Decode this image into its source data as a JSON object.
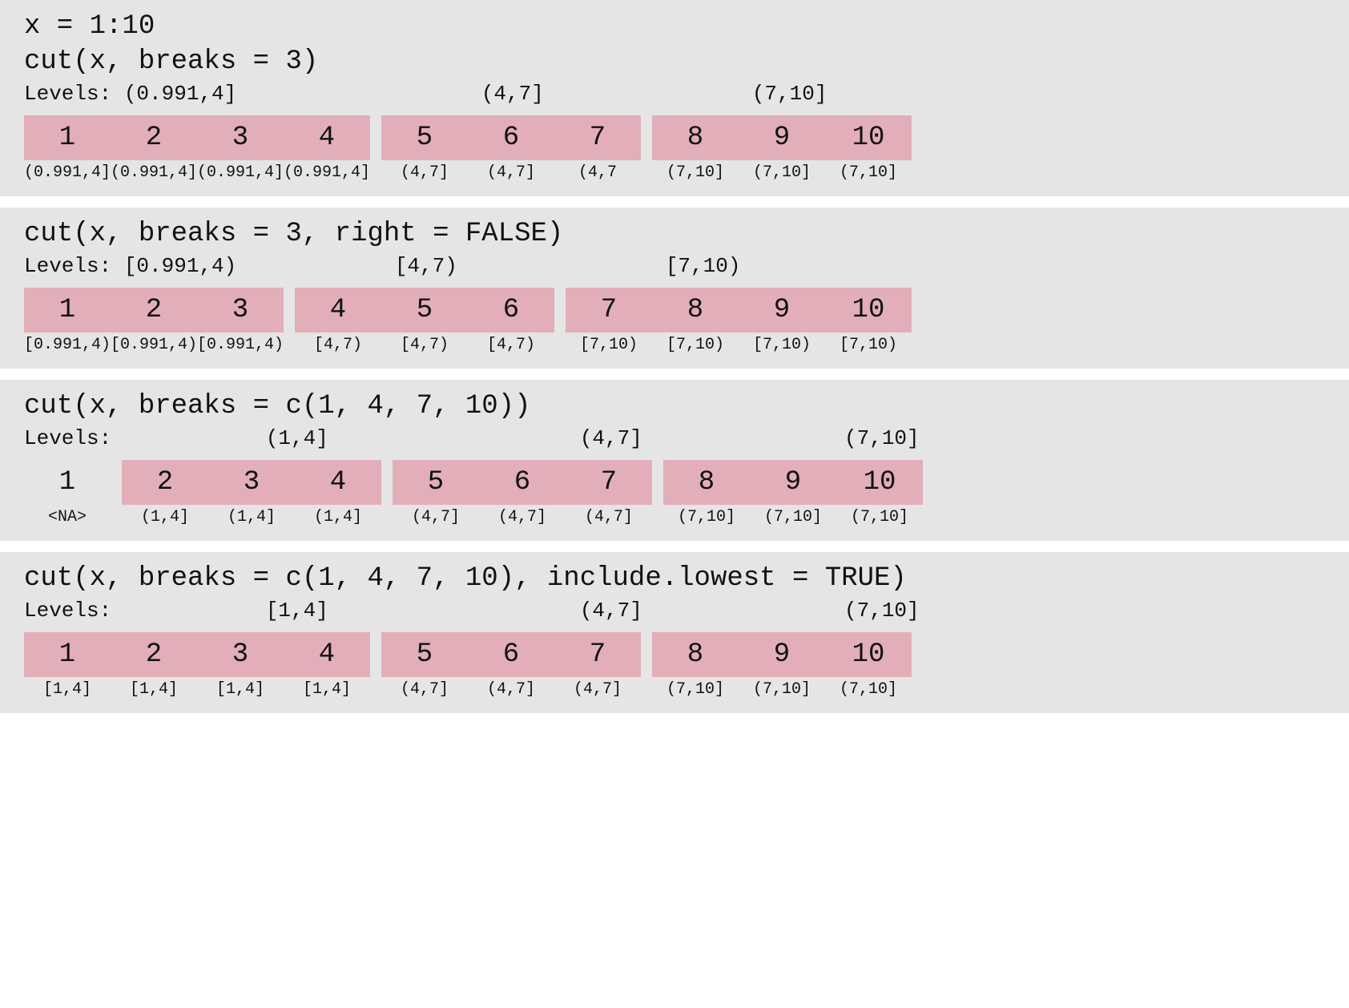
{
  "panels": [
    {
      "preCode": [
        "x = 1:10"
      ],
      "code": "cut(x, breaks = 3)",
      "levelsLabel": "Levels: ",
      "levelsGroups": [
        {
          "text": "(0.991,4]",
          "count": 4
        },
        {
          "text": "(4,7]",
          "count": 3
        },
        {
          "text": "(7,10]",
          "count": 3
        }
      ],
      "levelsAlign": "left",
      "valueGroups": [
        {
          "plain": false,
          "cells": [
            {
              "v": "1",
              "b": "(0.991,4]"
            },
            {
              "v": "2",
              "b": "(0.991,4]"
            },
            {
              "v": "3",
              "b": "(0.991,4]"
            },
            {
              "v": "4",
              "b": "(0.991,4]"
            }
          ]
        },
        {
          "plain": false,
          "cells": [
            {
              "v": "5",
              "b": "(4,7]"
            },
            {
              "v": "6",
              "b": "(4,7]"
            },
            {
              "v": "7",
              "b": "(4,7"
            }
          ]
        },
        {
          "plain": false,
          "cells": [
            {
              "v": "8",
              "b": "(7,10]"
            },
            {
              "v": "9",
              "b": "(7,10]"
            },
            {
              "v": "10",
              "b": "(7,10]"
            }
          ]
        }
      ]
    },
    {
      "preCode": [],
      "code": "cut(x, breaks = 3, right = FALSE)",
      "levelsLabel": "Levels: ",
      "levelsGroups": [
        {
          "text": "[0.991,4)",
          "count": 3
        },
        {
          "text": "[4,7)",
          "count": 3
        },
        {
          "text": "[7,10)",
          "count": 4
        }
      ],
      "levelsAlign": "left",
      "valueGroups": [
        {
          "plain": false,
          "cells": [
            {
              "v": "1",
              "b": "[0.991,4)"
            },
            {
              "v": "2",
              "b": "[0.991,4)"
            },
            {
              "v": "3",
              "b": "[0.991,4)"
            }
          ]
        },
        {
          "plain": false,
          "cells": [
            {
              "v": "4",
              "b": "[4,7)"
            },
            {
              "v": "5",
              "b": "[4,7)"
            },
            {
              "v": "6",
              "b": "[4,7)"
            }
          ]
        },
        {
          "plain": false,
          "cells": [
            {
              "v": "7",
              "b": "[7,10)"
            },
            {
              "v": "8",
              "b": "[7,10)"
            },
            {
              "v": "9",
              "b": "[7,10)"
            },
            {
              "v": "10",
              "b": "[7,10)"
            }
          ]
        }
      ]
    },
    {
      "preCode": [],
      "code": "cut(x, breaks = c(1, 4, 7, 10))",
      "levelsLabel": "Levels: ",
      "levelsGroups": [
        {
          "text": "(1,4]",
          "count": 4
        },
        {
          "text": "(4,7]",
          "count": 3
        },
        {
          "text": "(7,10]",
          "count": 3
        }
      ],
      "levelsAlign": "center",
      "valueGroups": [
        {
          "plain": true,
          "cells": [
            {
              "v": "1",
              "b": "<NA>"
            }
          ]
        },
        {
          "plain": false,
          "cells": [
            {
              "v": "2",
              "b": "(1,4]"
            },
            {
              "v": "3",
              "b": "(1,4]"
            },
            {
              "v": "4",
              "b": "(1,4]"
            }
          ]
        },
        {
          "plain": false,
          "cells": [
            {
              "v": "5",
              "b": "(4,7]"
            },
            {
              "v": "6",
              "b": "(4,7]"
            },
            {
              "v": "7",
              "b": "(4,7]"
            }
          ]
        },
        {
          "plain": false,
          "cells": [
            {
              "v": "8",
              "b": "(7,10]"
            },
            {
              "v": "9",
              "b": "(7,10]"
            },
            {
              "v": "10",
              "b": "(7,10]"
            }
          ]
        }
      ]
    },
    {
      "preCode": [],
      "code": "cut(x, breaks = c(1, 4, 7, 10), include.lowest = TRUE)",
      "levelsLabel": "Levels: ",
      "levelsGroups": [
        {
          "text": "[1,4]",
          "count": 4
        },
        {
          "text": "(4,7]",
          "count": 3
        },
        {
          "text": "(7,10]",
          "count": 3
        }
      ],
      "levelsAlign": "center",
      "valueGroups": [
        {
          "plain": false,
          "cells": [
            {
              "v": "1",
              "b": "[1,4]"
            },
            {
              "v": "2",
              "b": "[1,4]"
            },
            {
              "v": "3",
              "b": "[1,4]"
            },
            {
              "v": "4",
              "b": "[1,4]"
            }
          ]
        },
        {
          "plain": false,
          "cells": [
            {
              "v": "5",
              "b": "(4,7]"
            },
            {
              "v": "6",
              "b": "(4,7]"
            },
            {
              "v": "7",
              "b": "(4,7]"
            }
          ]
        },
        {
          "plain": false,
          "cells": [
            {
              "v": "8",
              "b": "(7,10]"
            },
            {
              "v": "9",
              "b": "(7,10]"
            },
            {
              "v": "10",
              "b": "(7,10]"
            }
          ]
        }
      ]
    }
  ],
  "layout": {
    "cellWidth": 108,
    "groupGap": 14
  }
}
